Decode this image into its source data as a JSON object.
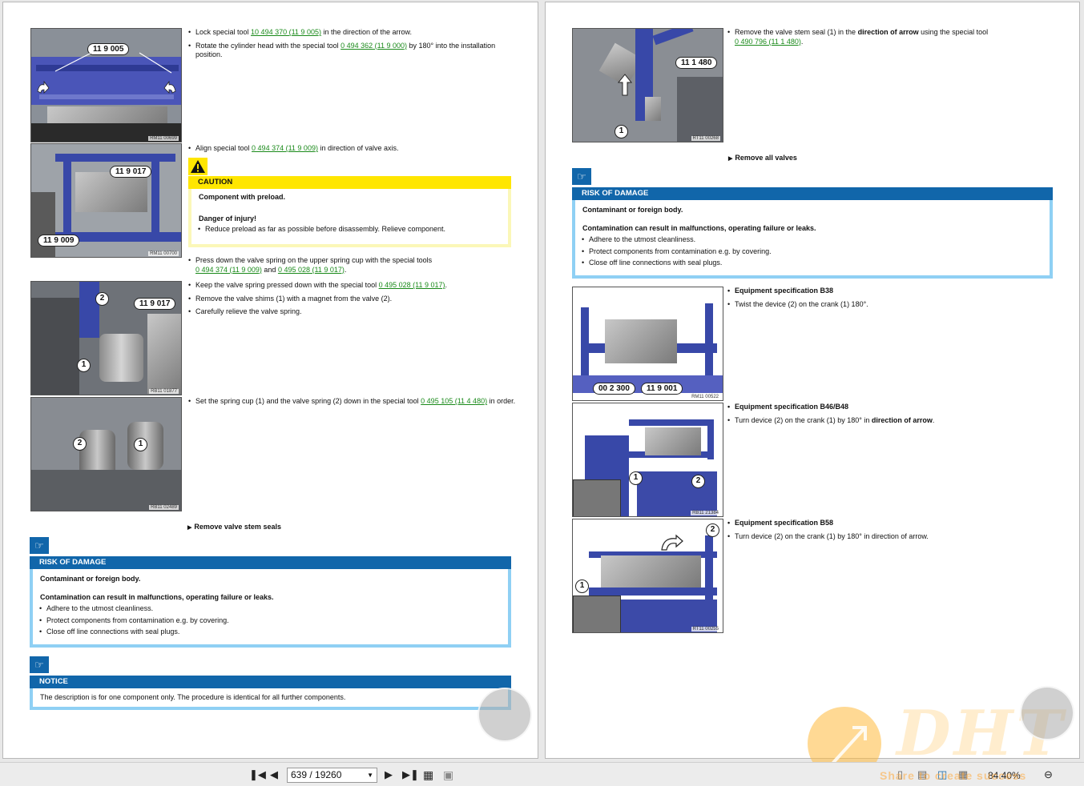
{
  "left_page": {
    "figures": [
      {
        "code": "RM11 00699",
        "callouts": [
          "11 9 005"
        ]
      },
      {
        "code": "RM11 00700",
        "callouts": [
          "11 9 017",
          "11 9 009"
        ]
      },
      {
        "code": "RB11 01877",
        "callouts": [
          "11 9 017"
        ],
        "numbers": [
          "1",
          "2"
        ]
      },
      {
        "code": "RB11 02489",
        "numbers": [
          "1",
          "2"
        ]
      }
    ],
    "b1": {
      "pre": "Lock special tool ",
      "link": "10 494 370 (11 9 005)",
      "post": " in the direction of the arrow."
    },
    "b2": {
      "pre": "Rotate the cylinder head with the special tool ",
      "link": "0 494 362 (11 9 000)",
      "post": " by 180° into the installation position."
    },
    "b3": {
      "pre": "Align special tool ",
      "link": "0 494 374 (11 9 009)",
      "post": " in direction of valve axis."
    },
    "caution": {
      "title": "CAUTION",
      "line1": "Component with preload.",
      "line2": "Danger of injury!",
      "bullet": "Reduce preload as far as possible before disassembly. Relieve component."
    },
    "b4": {
      "pre": "Press down the valve spring on the upper spring cup with the special tools",
      "link1": "0 494 374 (11 9 009)",
      "mid": " and ",
      "link2": "0 495 028 (11 9 017)",
      "post": "."
    },
    "b5": {
      "pre": "Keep the valve spring pressed down with the special tool ",
      "link": "0 495 028 (11 9 017)",
      "post": "."
    },
    "b6": "Remove the valve shims (1) with a magnet from the valve (2).",
    "b7": "Carefully relieve the valve spring.",
    "b8": {
      "pre": "Set the spring cup (1) and the valve spring (2) down in the special tool ",
      "link": "0 495 105 (11 4 480)",
      "post": " in order."
    },
    "step": "Remove valve stem seals",
    "risk": {
      "title": "RISK OF DAMAGE",
      "line1": "Contaminant or foreign body.",
      "line2": "Contamination can result in malfunctions, operating failure or leaks.",
      "bullets": [
        "Adhere to the utmost cleanliness.",
        "Protect components from contamination e.g. by covering.",
        "Close off line connections with seal plugs."
      ]
    },
    "notice": {
      "title": "NOTICE",
      "text": "The description is for one component only. The procedure is identical for all further components."
    }
  },
  "right_page": {
    "figures": [
      {
        "code": "RT11 00268",
        "callouts": [
          "11 1 480"
        ],
        "numbers": [
          "1"
        ]
      },
      {
        "code": "RM11 00522",
        "callouts": [
          "00 2 300",
          "11 9 001"
        ]
      },
      {
        "code": "RB11 21384",
        "numbers": [
          "1",
          "2"
        ]
      },
      {
        "code": "RT11 00255",
        "numbers": [
          "1",
          "2"
        ]
      }
    ],
    "b1": {
      "pre": "Remove the valve stem seal (1) in the ",
      "bold": "direction of arrow",
      "mid": " using the special tool ",
      "link": "0 490 796 (11 1 480)",
      "post": "."
    },
    "step": "Remove all valves",
    "risk": {
      "title": "RISK OF DAMAGE",
      "line1": "Contaminant or foreign body.",
      "line2": "Contamination can result in malfunctions, operating failure or leaks.",
      "bullets": [
        "Adhere to the utmost cleanliness.",
        "Protect components from contamination e.g. by covering.",
        "Close off line connections with seal plugs."
      ]
    },
    "spec1": {
      "title": "Equipment specification B38",
      "text": "Twist the device (2) on the crank (1) 180°."
    },
    "spec2": {
      "title": "Equipment specification B46/B48",
      "pre": "Turn device (2) on the crank (1) by 180° in ",
      "bold": "direction of arrow",
      "post": "."
    },
    "spec3": {
      "title": "Equipment specification B58",
      "text": "Turn device (2) on the crank (1) by 180° in direction of arrow."
    }
  },
  "toolbar": {
    "page_value": "639 / 19260",
    "zoom": "84.40%"
  },
  "watermark": {
    "brand": "DHT",
    "tagline": "Share to create success"
  },
  "colors": {
    "notice_blue": "#1166aa",
    "notice_border": "#8fd0f4",
    "caution_yellow": "#ffe600",
    "link_green": "#1a8a1a",
    "tool_blue": "#3848a8"
  }
}
